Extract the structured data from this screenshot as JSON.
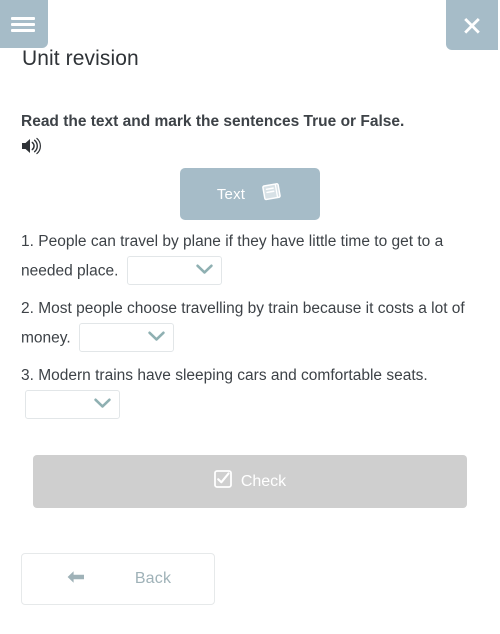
{
  "header": {
    "menu_icon": "hamburger-menu-icon",
    "close_icon": "close-icon",
    "accent_color": "#a6bcc8"
  },
  "page_title": "Unit revision",
  "instruction": {
    "text": "Read the text and mark the sentences True or False.",
    "audio_icon": "speaker-icon"
  },
  "text_button": {
    "label": "Text",
    "icon": "book-icon"
  },
  "questions": [
    {
      "number": "1.",
      "text": "People can travel by plane if they have little time to get to a needed place.",
      "selected_value": "",
      "chevron_icon": "chevron-down-icon"
    },
    {
      "number": "2.",
      "text": "Most people choose travelling by train because it costs a lot of money.",
      "selected_value": "",
      "chevron_icon": "chevron-down-icon"
    },
    {
      "number": "3.",
      "text": "Modern trains have sleeping cars and comfortable seats.",
      "selected_value": "",
      "chevron_icon": "chevron-down-icon"
    }
  ],
  "check_button": {
    "label": "Check",
    "icon": "checkbox-checked-icon",
    "color": "#cfcfcf"
  },
  "back_button": {
    "label": "Back",
    "icon": "arrow-left-icon",
    "color": "#9fb2b8"
  }
}
